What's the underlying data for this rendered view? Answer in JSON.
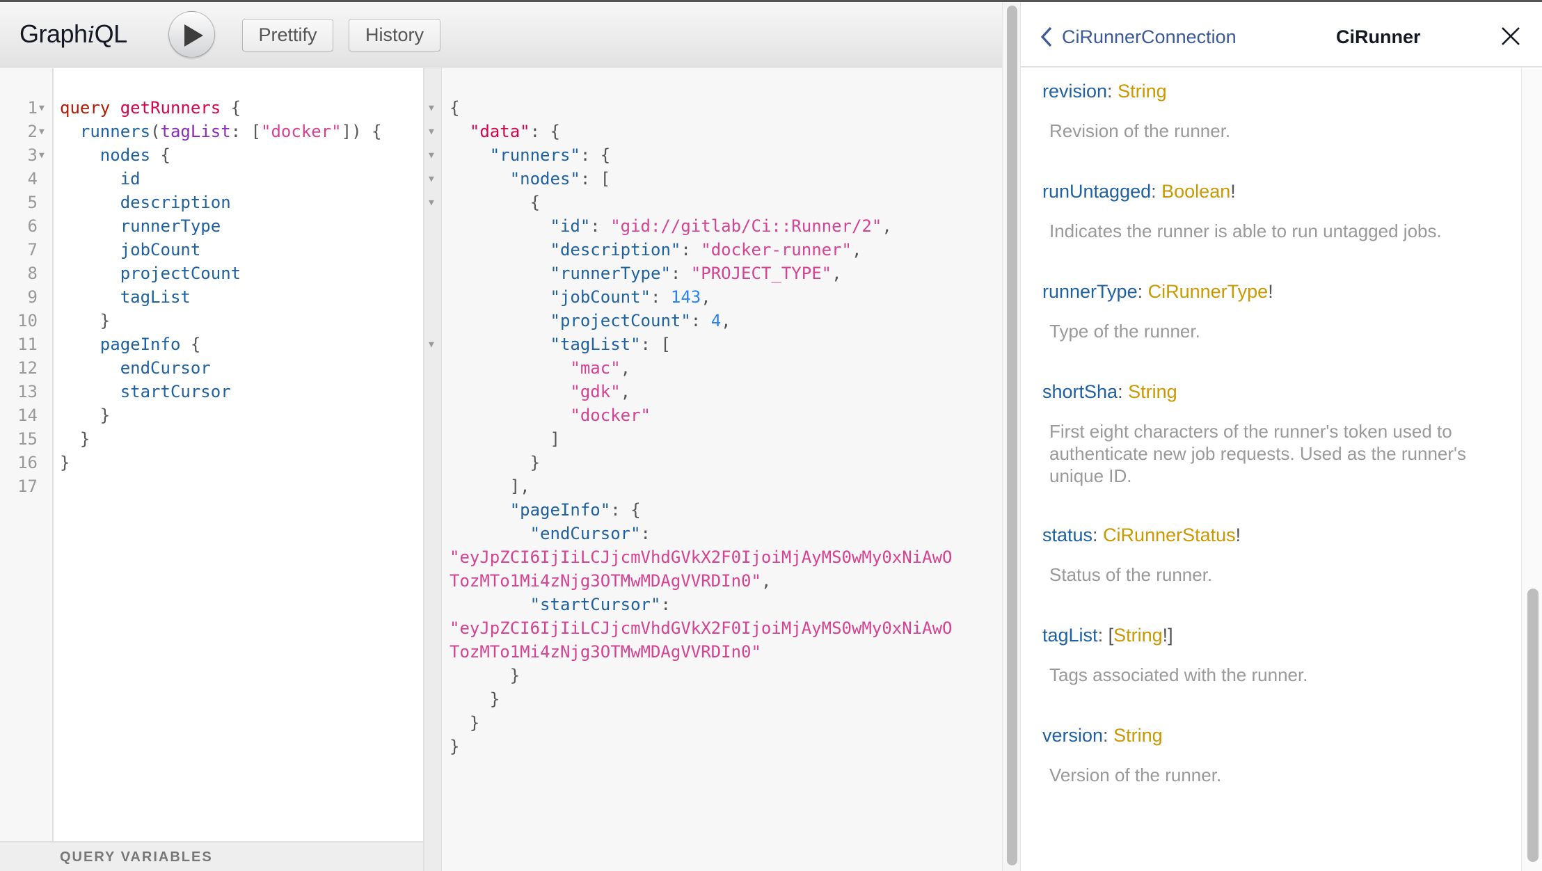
{
  "toolbar": {
    "title_prefix": "Graph",
    "title_italic": "i",
    "title_suffix": "QL",
    "execute_icon": "play-icon",
    "prettify_label": "Prettify",
    "history_label": "History"
  },
  "query_editor": {
    "line_numbers": [
      "1",
      "2",
      "3",
      "4",
      "5",
      "6",
      "7",
      "8",
      "9",
      "10",
      "11",
      "12",
      "13",
      "14",
      "15",
      "16",
      "17"
    ],
    "folds": [
      true,
      true,
      true,
      false,
      false,
      false,
      false,
      false,
      false,
      false,
      false,
      false,
      false,
      false,
      false,
      false,
      false
    ],
    "lines": [
      [
        {
          "t": "kw",
          "v": "query"
        },
        {
          "t": "punc",
          "v": " "
        },
        {
          "t": "def",
          "v": "getRunners"
        },
        {
          "t": "punc",
          "v": " {"
        }
      ],
      [
        {
          "t": "punc",
          "v": "  "
        },
        {
          "t": "prop",
          "v": "runners"
        },
        {
          "t": "punc",
          "v": "("
        },
        {
          "t": "attr",
          "v": "tagList"
        },
        {
          "t": "punc",
          "v": ": ["
        },
        {
          "t": "str",
          "v": "\"docker\""
        },
        {
          "t": "punc",
          "v": "]) {"
        }
      ],
      [
        {
          "t": "punc",
          "v": "    "
        },
        {
          "t": "prop",
          "v": "nodes"
        },
        {
          "t": "punc",
          "v": " {"
        }
      ],
      [
        {
          "t": "punc",
          "v": "      "
        },
        {
          "t": "prop",
          "v": "id"
        }
      ],
      [
        {
          "t": "punc",
          "v": "      "
        },
        {
          "t": "prop",
          "v": "description"
        }
      ],
      [
        {
          "t": "punc",
          "v": "      "
        },
        {
          "t": "prop",
          "v": "runnerType"
        }
      ],
      [
        {
          "t": "punc",
          "v": "      "
        },
        {
          "t": "prop",
          "v": "jobCount"
        }
      ],
      [
        {
          "t": "punc",
          "v": "      "
        },
        {
          "t": "prop",
          "v": "projectCount"
        }
      ],
      [
        {
          "t": "punc",
          "v": "      "
        },
        {
          "t": "prop",
          "v": "tagList"
        }
      ],
      [
        {
          "t": "punc",
          "v": "    }"
        }
      ],
      [
        {
          "t": "punc",
          "v": "    "
        },
        {
          "t": "prop",
          "v": "pageInfo"
        },
        {
          "t": "punc",
          "v": " {"
        }
      ],
      [
        {
          "t": "punc",
          "v": "      "
        },
        {
          "t": "prop",
          "v": "endCursor"
        }
      ],
      [
        {
          "t": "punc",
          "v": "      "
        },
        {
          "t": "prop",
          "v": "startCursor"
        }
      ],
      [
        {
          "t": "punc",
          "v": "    }"
        }
      ],
      [
        {
          "t": "punc",
          "v": "  }"
        }
      ],
      [
        {
          "t": "punc",
          "v": "}"
        }
      ],
      []
    ]
  },
  "query_variables": {
    "title": "QUERY VARIABLES"
  },
  "result": {
    "folds": [
      true,
      true,
      true,
      true,
      true,
      false,
      false,
      false,
      false,
      false,
      true,
      false,
      false,
      false,
      false,
      false,
      false,
      false,
      false,
      false,
      false,
      false,
      false,
      false,
      false,
      false,
      false,
      false
    ],
    "lines": [
      [
        {
          "t": "punc",
          "v": "{"
        }
      ],
      [
        {
          "t": "punc",
          "v": "  "
        },
        {
          "t": "def",
          "v": "\"data\""
        },
        {
          "t": "punc",
          "v": ": {"
        }
      ],
      [
        {
          "t": "punc",
          "v": "    "
        },
        {
          "t": "prop",
          "v": "\"runners\""
        },
        {
          "t": "punc",
          "v": ": {"
        }
      ],
      [
        {
          "t": "punc",
          "v": "      "
        },
        {
          "t": "prop",
          "v": "\"nodes\""
        },
        {
          "t": "punc",
          "v": ": ["
        }
      ],
      [
        {
          "t": "punc",
          "v": "        {"
        }
      ],
      [
        {
          "t": "punc",
          "v": "          "
        },
        {
          "t": "prop",
          "v": "\"id\""
        },
        {
          "t": "punc",
          "v": ": "
        },
        {
          "t": "str",
          "v": "\"gid://gitlab/Ci::Runner/2\""
        },
        {
          "t": "punc",
          "v": ","
        }
      ],
      [
        {
          "t": "punc",
          "v": "          "
        },
        {
          "t": "prop",
          "v": "\"description\""
        },
        {
          "t": "punc",
          "v": ": "
        },
        {
          "t": "str",
          "v": "\"docker-runner\""
        },
        {
          "t": "punc",
          "v": ","
        }
      ],
      [
        {
          "t": "punc",
          "v": "          "
        },
        {
          "t": "prop",
          "v": "\"runnerType\""
        },
        {
          "t": "punc",
          "v": ": "
        },
        {
          "t": "str",
          "v": "\"PROJECT_TYPE\""
        },
        {
          "t": "punc",
          "v": ","
        }
      ],
      [
        {
          "t": "punc",
          "v": "          "
        },
        {
          "t": "prop",
          "v": "\"jobCount\""
        },
        {
          "t": "punc",
          "v": ": "
        },
        {
          "t": "num",
          "v": "143"
        },
        {
          "t": "punc",
          "v": ","
        }
      ],
      [
        {
          "t": "punc",
          "v": "          "
        },
        {
          "t": "prop",
          "v": "\"projectCount\""
        },
        {
          "t": "punc",
          "v": ": "
        },
        {
          "t": "num",
          "v": "4"
        },
        {
          "t": "punc",
          "v": ","
        }
      ],
      [
        {
          "t": "punc",
          "v": "          "
        },
        {
          "t": "prop",
          "v": "\"tagList\""
        },
        {
          "t": "punc",
          "v": ": ["
        }
      ],
      [
        {
          "t": "punc",
          "v": "            "
        },
        {
          "t": "str",
          "v": "\"mac\""
        },
        {
          "t": "punc",
          "v": ","
        }
      ],
      [
        {
          "t": "punc",
          "v": "            "
        },
        {
          "t": "str",
          "v": "\"gdk\""
        },
        {
          "t": "punc",
          "v": ","
        }
      ],
      [
        {
          "t": "punc",
          "v": "            "
        },
        {
          "t": "str",
          "v": "\"docker\""
        }
      ],
      [
        {
          "t": "punc",
          "v": "          ]"
        }
      ],
      [
        {
          "t": "punc",
          "v": "        }"
        }
      ],
      [
        {
          "t": "punc",
          "v": "      ],"
        }
      ],
      [
        {
          "t": "punc",
          "v": "      "
        },
        {
          "t": "prop",
          "v": "\"pageInfo\""
        },
        {
          "t": "punc",
          "v": ": {"
        }
      ],
      [
        {
          "t": "punc",
          "v": "        "
        },
        {
          "t": "prop",
          "v": "\"endCursor\""
        },
        {
          "t": "punc",
          "v": ":"
        }
      ],
      [
        {
          "t": "str",
          "v": "\"eyJpZCI6IjIiLCJjcmVhdGVkX2F0IjoiMjAyMS0wMy0xNiAwO"
        }
      ],
      [
        {
          "t": "str",
          "v": "TozMTo1Mi4zNjg3OTMwMDAgVVRDIn0\""
        },
        {
          "t": "punc",
          "v": ","
        }
      ],
      [
        {
          "t": "punc",
          "v": "        "
        },
        {
          "t": "prop",
          "v": "\"startCursor\""
        },
        {
          "t": "punc",
          "v": ":"
        }
      ],
      [
        {
          "t": "str",
          "v": "\"eyJpZCI6IjIiLCJjcmVhdGVkX2F0IjoiMjAyMS0wMy0xNiAwO"
        }
      ],
      [
        {
          "t": "str",
          "v": "TozMTo1Mi4zNjg3OTMwMDAgVVRDIn0\""
        }
      ],
      [
        {
          "t": "punc",
          "v": "      }"
        }
      ],
      [
        {
          "t": "punc",
          "v": "    }"
        }
      ],
      [
        {
          "t": "punc",
          "v": "  }"
        }
      ],
      [
        {
          "t": "punc",
          "v": "}"
        }
      ]
    ]
  },
  "docs": {
    "back_label": "CiRunnerConnection",
    "back_icon": "chevron-left-icon",
    "title": "CiRunner",
    "close_icon": "close-icon",
    "fields": [
      {
        "name": "revision",
        "prefix": "",
        "type": "String",
        "suffix": "",
        "description": "Revision of the runner."
      },
      {
        "name": "runUntagged",
        "prefix": "",
        "type": "Boolean",
        "suffix": "!",
        "description": "Indicates the runner is able to run untagged jobs."
      },
      {
        "name": "runnerType",
        "prefix": "",
        "type": "CiRunnerType",
        "suffix": "!",
        "description": "Type of the runner."
      },
      {
        "name": "shortSha",
        "prefix": "",
        "type": "String",
        "suffix": "",
        "description": "First eight characters of the runner's token used to authenticate new job requests. Used as the runner's unique ID."
      },
      {
        "name": "status",
        "prefix": "",
        "type": "CiRunnerStatus",
        "suffix": "!",
        "description": "Status of the runner."
      },
      {
        "name": "tagList",
        "prefix": "[",
        "type": "String",
        "suffix": "!]",
        "description": "Tags associated with the runner."
      },
      {
        "name": "version",
        "prefix": "",
        "type": "String",
        "suffix": "",
        "description": "Version of the runner."
      }
    ]
  }
}
